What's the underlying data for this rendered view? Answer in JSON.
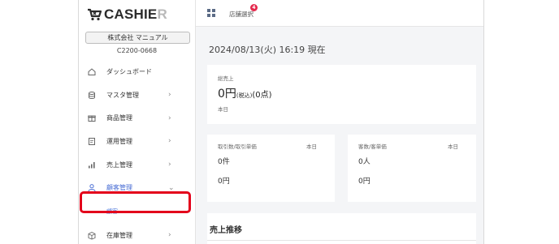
{
  "brand": {
    "logo_main": "CASHIE",
    "logo_tail": "R"
  },
  "company": {
    "name": "株式会社 マニュアル",
    "code": "C2200-0668"
  },
  "nav": {
    "dashboard": "ダッシュボード",
    "master": "マスタ管理",
    "products": "商品管理",
    "operations": "運用管理",
    "sales": "売上管理",
    "customers": "顧客管理",
    "customers_sub": "顧客",
    "inventory": "在庫管理"
  },
  "header": {
    "store_select": "店舗選択",
    "badge_count": "4"
  },
  "main": {
    "datetime": "2024/08/13(火) 16:19 現在",
    "total_sales": {
      "label": "総売上",
      "amount": "0円",
      "tax_note": "(税込)",
      "points": "(0点)",
      "period": "本日"
    },
    "transactions": {
      "label": "取引数/取引単価",
      "period": "本日",
      "count": "0件",
      "unit_price": "0円"
    },
    "customers": {
      "label": "客数/客単価",
      "period": "本日",
      "count": "0人",
      "unit_price": "0円"
    },
    "trend_title": "売上推移"
  },
  "colors": {
    "accent": "#4a6ed4",
    "highlight": "#e3001b",
    "badge": "#e4294c"
  }
}
